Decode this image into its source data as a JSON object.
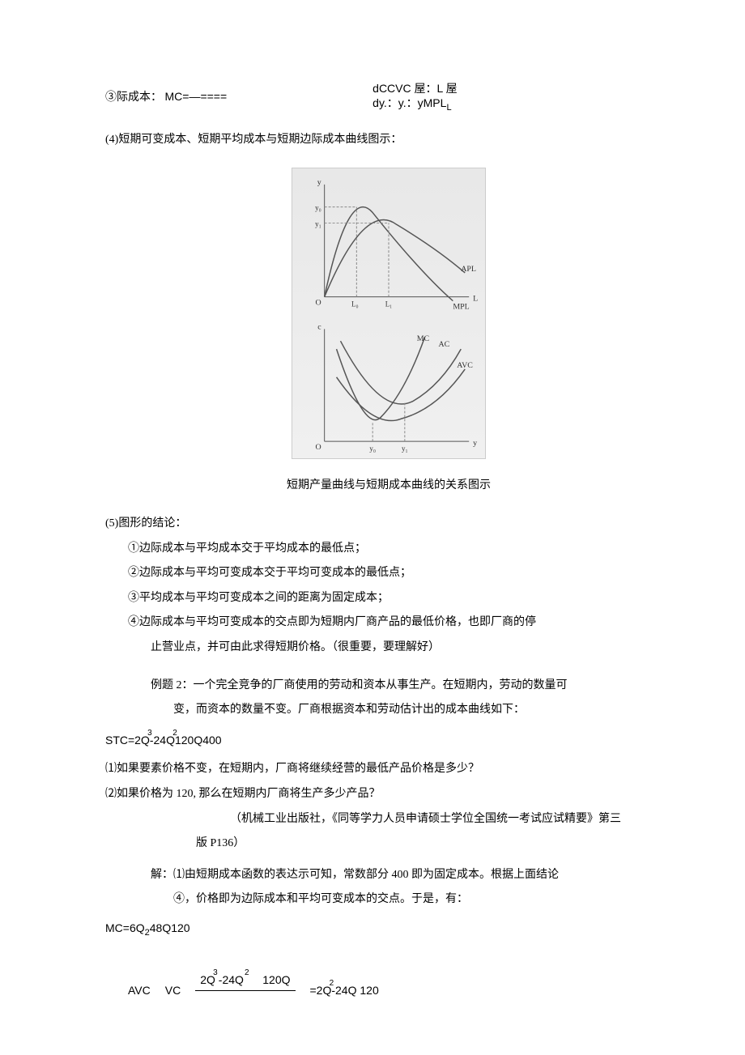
{
  "formula_mc": {
    "left_label": "③际成本：",
    "left_eq": "MC=—====",
    "right_top": "dCCVC 屋：L 屋",
    "right_bot": "dy.：y.：yMPL"
  },
  "section_4": "(4)短期可变成本、短期平均成本与短期边际成本曲线图示：",
  "figure": {
    "y_upper": "y",
    "y0": "y₀",
    "y1": "y₁",
    "L0": "L₀",
    "L1": "L₁",
    "APL": "APL",
    "MPL": "MPL",
    "L_axis": "L",
    "O1": "O",
    "c_axis": "c",
    "MC": "MC",
    "AC": "AC",
    "AVC": "AVC",
    "O2": "O",
    "y_axis2": "y",
    "yb0": "y₀",
    "yb1": "y₁",
    "caption": "短期产量曲线与短期成本曲线的关系图示"
  },
  "section_5": {
    "title": "(5)图形的结论：",
    "pt1": "①边际成本与平均成本交于平均成本的最低点；",
    "pt2": "②边际成本与平均可变成本交于平均可变成本的最低点；",
    "pt3": "③平均成本与平均可变成本之间的距离为固定成本；",
    "pt4a": "④边际成本与平均可变成本的交点即为短期内厂商产品的最低价格，也即厂商的停",
    "pt4b": "止营业点，并可由此求得短期价格。（很重要，要理解好）"
  },
  "example2": {
    "line1": "例题 2：一个完全竞争的厂商使用的劳动和资本从事生产。在短期内，劳动的数量可",
    "line2": "变，而资本的数量不变。厂商根据资本和劳动估计出的成本曲线如下："
  },
  "stc": {
    "text": "STC=2Q-24Q120Q400",
    "sup1": "3",
    "sup2": "2"
  },
  "questions": {
    "q1": "⑴如果要素价格不变，在短期内，厂商将继续经营的最低产品价格是多少？",
    "q2": "⑵如果价格为 120, 那么在短期内厂商将生产多少产品？",
    "src1": "（机械工业出版社，《同等学力人员申请硕士学位全国统一考试应试精要》第三",
    "src2": "版 P136）"
  },
  "solution": {
    "line1": "解：⑴由短期成本函数的表达示可知，常数部分 400 即为固定成本。根据上面结论",
    "line2": "④，价格即为边际成本和平均可变成本的交点。于是，有："
  },
  "mc_eq": "MC=6Q248Q120",
  "avc": {
    "label": "AVC",
    "vc": "VC",
    "num_a": "2Q",
    "num_a_sup": "3",
    "num_b": "-24Q",
    "num_b_sup": "2",
    "num_c": "120Q",
    "rhs_a": "=2Q",
    "rhs_a_sup": "2",
    "rhs_b": "-24Q 120"
  },
  "chart_data": [
    {
      "type": "line",
      "title": "Short-run product curves (APL, MPL)",
      "xlabel": "L",
      "ylabel": "y",
      "x_ticks": [
        "L0",
        "L1"
      ],
      "y_ticks": [
        "y1",
        "y0"
      ],
      "series": [
        {
          "name": "APL",
          "shape": "inverted-U, peaks near L1 at y1, then declines"
        },
        {
          "name": "MPL",
          "shape": "inverted-U, peaks near L0 at y0, crosses APL at its peak (L1,y1), then falls faster, crosses x-axis"
        }
      ],
      "annotations": [
        "MPL intersects APL at APL max",
        "dashed guides at L0,L1 and y0,y1"
      ]
    },
    {
      "type": "line",
      "title": "Short-run cost curves (MC, AC, AVC)",
      "xlabel": "y",
      "ylabel": "c",
      "x_ticks": [
        "y0",
        "y1"
      ],
      "series": [
        {
          "name": "MC",
          "shape": "U-shaped, steepest, minimum near y0"
        },
        {
          "name": "AC",
          "shape": "U-shaped, minimum around/after y1, MC crosses at min"
        },
        {
          "name": "AVC",
          "shape": "U-shaped, minimum near y0-y1 region, MC crosses at min, below AC"
        }
      ],
      "annotations": [
        "dashed guides at y0,y1",
        "MC intersects AVC and AC at their minimum points"
      ]
    }
  ]
}
